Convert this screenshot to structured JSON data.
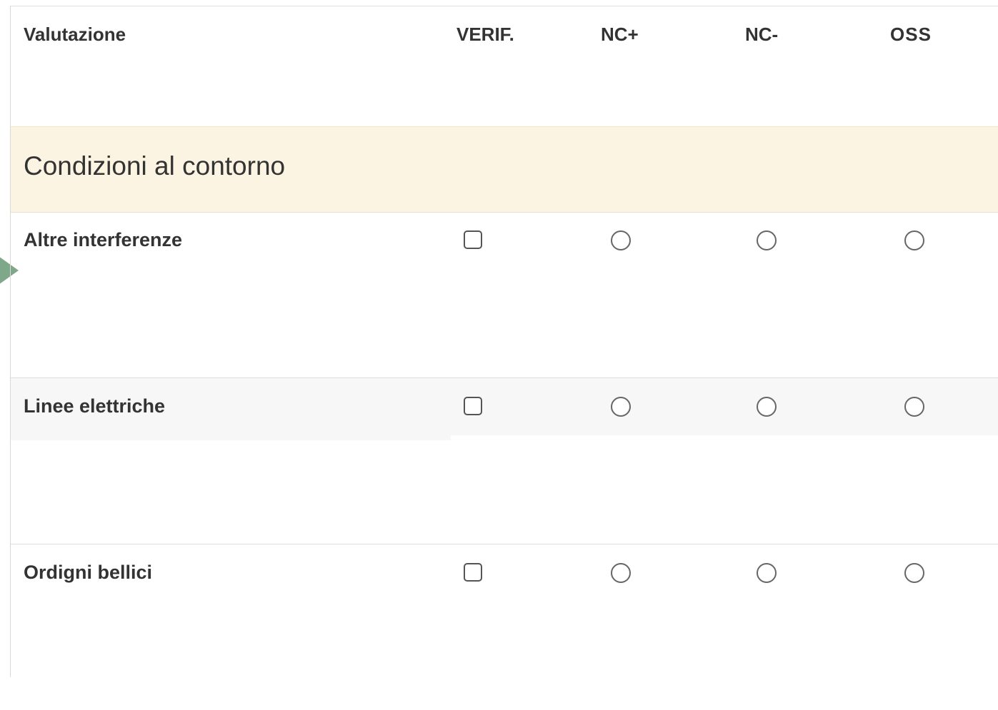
{
  "table": {
    "columns": [
      "Valutazione",
      "VERIF.",
      "NC+",
      "NC-",
      "OSS"
    ],
    "section": "Condizioni al contorno",
    "rows": [
      {
        "label": "Altre interferenze",
        "verif": false,
        "selection": null
      },
      {
        "label": "Linee elettriche",
        "verif": false,
        "selection": null
      },
      {
        "label": "Ordigni bellici",
        "verif": false,
        "selection": null
      }
    ]
  },
  "colors": {
    "section_bg": "#fcf4e2",
    "arrow": "#7fa88a",
    "alt_row_bg": "#f7f7f7"
  }
}
